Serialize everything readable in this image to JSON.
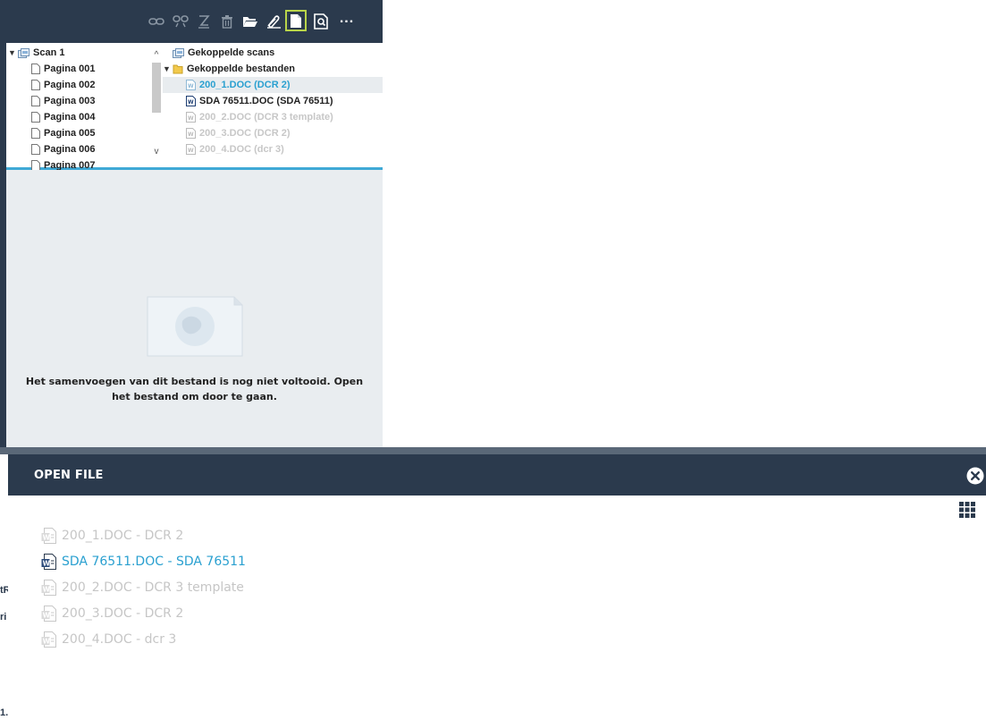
{
  "toolbar": {
    "buttons": [
      {
        "icon": "link-icon"
      },
      {
        "icon": "unlink-icon"
      },
      {
        "icon": "rename-icon"
      },
      {
        "icon": "trash-icon"
      },
      {
        "icon": "folder-open-icon"
      },
      {
        "icon": "attach-icon"
      },
      {
        "icon": "document-icon",
        "active": true
      },
      {
        "icon": "search-document-icon"
      }
    ],
    "more_label": "..."
  },
  "scan_tree": {
    "root": "Scan 1",
    "pages": [
      "Pagina 001",
      "Pagina 002",
      "Pagina 003",
      "Pagina 004",
      "Pagina 005",
      "Pagina 006",
      "Pagina 007"
    ]
  },
  "linked_tree": {
    "linked_scans": "Gekoppelde scans",
    "linked_files": "Gekoppelde bestanden",
    "files": [
      {
        "label": "200_1.DOC (DCR 2)",
        "state": "selected"
      },
      {
        "label": "SDA 76511.DOC (SDA 76511)",
        "state": "normal"
      },
      {
        "label": "200_2.DOC (DCR 3 template)",
        "state": "disabled"
      },
      {
        "label": "200_3.DOC (DCR 2)",
        "state": "disabled"
      },
      {
        "label": "200_4.DOC (dcr 3)",
        "state": "disabled"
      }
    ]
  },
  "preview": {
    "message": "Het samenvoegen van dit bestand is nog niet voltooid. Open het bestand om door te gaan."
  },
  "left_fragments": [
    "tR",
    "ri",
    "1."
  ],
  "dialog": {
    "title": "OPEN FILE",
    "files": [
      {
        "label": "200_1.DOC - DCR 2",
        "state": "disabled"
      },
      {
        "label": "SDA 76511.DOC - SDA 76511",
        "state": "active"
      },
      {
        "label": "200_2.DOC - DCR 3 template",
        "state": "disabled"
      },
      {
        "label": "200_3.DOC - DCR 2",
        "state": "disabled"
      },
      {
        "label": "200_4.DOC - dcr 3",
        "state": "disabled"
      }
    ]
  },
  "colors": {
    "header": "#2b3a4d",
    "accent": "#2aa0d0",
    "active_outline": "#b8d44a",
    "disabled_text": "#c6c6c6"
  }
}
